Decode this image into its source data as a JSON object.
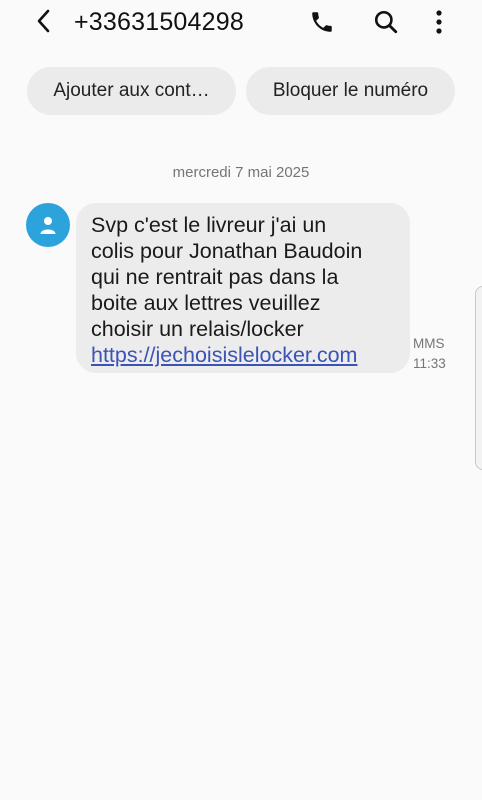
{
  "header": {
    "title": "+33631504298",
    "back_icon": "back-arrow-icon",
    "call_icon": "phone-icon",
    "search_icon": "search-icon",
    "more_icon": "more-vertical-icon"
  },
  "actions": {
    "add_contact_label": "Ajouter aux cont…",
    "block_label": "Bloquer le numéro"
  },
  "conversation": {
    "date_divider": "mercredi 7 mai 2025",
    "messages": [
      {
        "lines": [
          "Svp c'est le livreur j'ai un",
          "colis pour Jonathan Baudoin",
          "qui ne rentrait pas dans la",
          "boite aux lettres veuillez",
          "choisir un relais/locker"
        ],
        "link": "https://jechoisislelocker.com",
        "type": "MMS",
        "time": "11:33"
      }
    ]
  },
  "colors": {
    "avatar": "#2da3dc",
    "bubble": "#ececec",
    "link": "#3b53b5",
    "chip": "#ebebeb"
  }
}
